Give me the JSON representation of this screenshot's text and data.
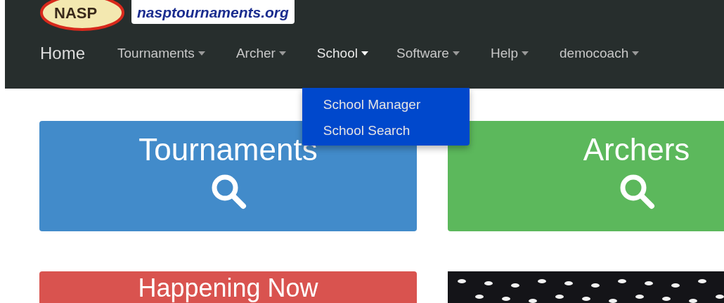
{
  "header": {
    "logo_text": "NASP",
    "site_name": "nasptournaments.org"
  },
  "nav": {
    "brand": "Home",
    "items": [
      {
        "label": "Tournaments",
        "selected": false
      },
      {
        "label": "Archer",
        "selected": false
      },
      {
        "label": "School",
        "selected": true,
        "menu": [
          "School Manager",
          "School Search"
        ]
      },
      {
        "label": "Software",
        "selected": false
      },
      {
        "label": "Help",
        "selected": false
      },
      {
        "label": "democoach",
        "selected": false
      }
    ]
  },
  "tiles": [
    {
      "title": "Tournaments",
      "kind": "search",
      "color": "#428bca"
    },
    {
      "title": "Archers",
      "kind": "search",
      "color": "#5cb85c"
    },
    {
      "title": "Happening Now",
      "kind": "text",
      "color": "#d9534f"
    },
    {
      "kind": "photo"
    }
  ]
}
